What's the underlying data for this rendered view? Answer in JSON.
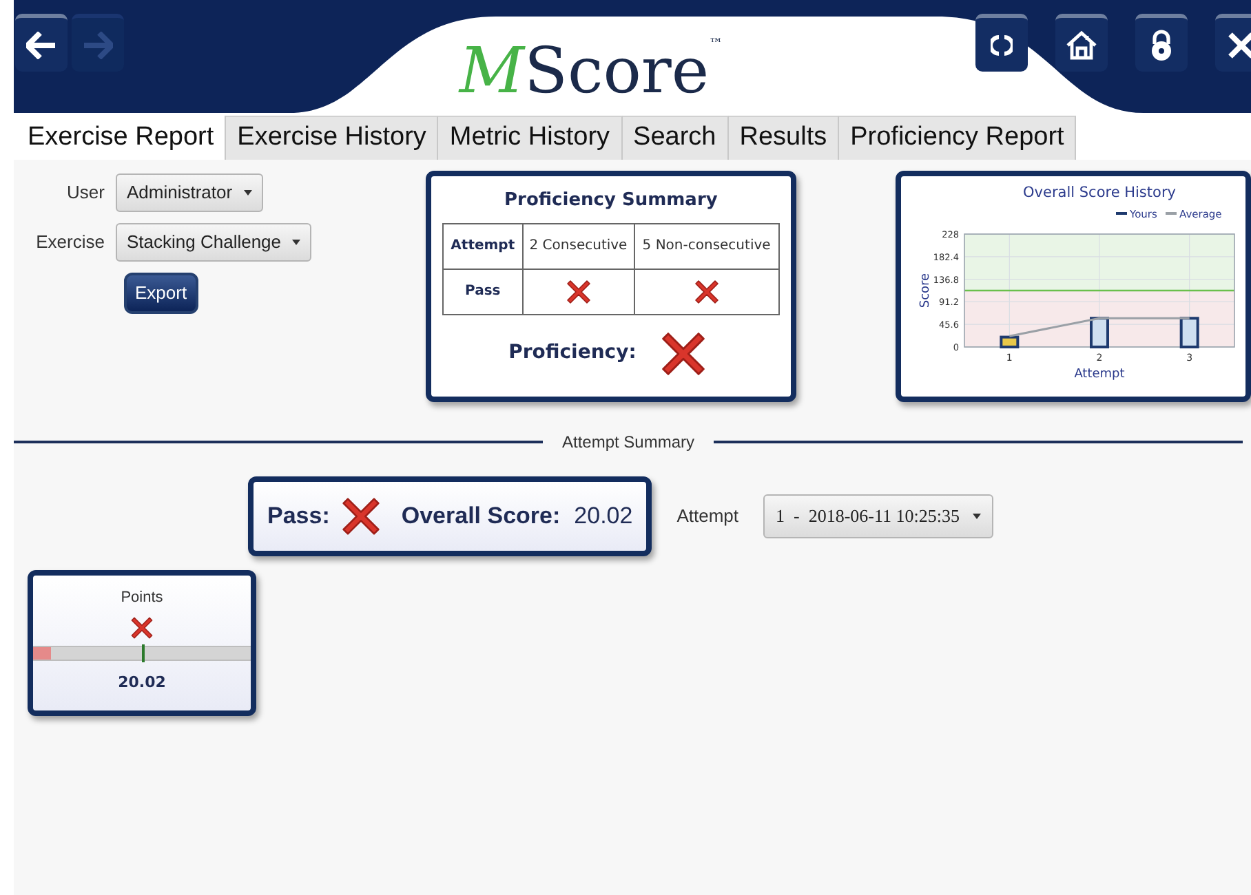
{
  "header": {
    "nav_buttons": [
      {
        "kind": "back",
        "disabled": false
      },
      {
        "kind": "forward",
        "disabled": true
      }
    ],
    "logo": {
      "accent": "M",
      "rest": "Score",
      "mark": "™"
    },
    "tool_buttons": [
      {
        "kind": "refresh"
      },
      {
        "kind": "home"
      },
      {
        "kind": "lock"
      },
      {
        "kind": "close"
      }
    ]
  },
  "tabs": [
    {
      "label": "Exercise Report",
      "selected": true
    },
    {
      "label": "Exercise History",
      "selected": false
    },
    {
      "label": "Metric History",
      "selected": false
    },
    {
      "label": "Search",
      "selected": false
    },
    {
      "label": "Results",
      "selected": false
    },
    {
      "label": "Proficiency Report",
      "selected": false
    }
  ],
  "filters": [
    {
      "label": "User",
      "value": "Administrator"
    },
    {
      "label": "Exercise",
      "value": "Stacking Challenge"
    }
  ],
  "export_button": "Export",
  "proficiency_summary": {
    "title": "Proficiency Summary",
    "row_header": "Attempt",
    "columns": [
      "2 Consecutive",
      "5 Non-consecutive"
    ],
    "pass_label": "Pass",
    "pass": [
      false,
      false
    ],
    "proficiency_label": "Proficiency:",
    "proficient": false
  },
  "score_history": {
    "chart_data": {
      "type": "bar",
      "title": "Overall Score History",
      "xlabel": "Attempt",
      "ylabel": "Score",
      "categories": [
        "1",
        "2",
        "3"
      ],
      "series": [
        {
          "name": "Yours",
          "color": "#1e3a6e",
          "values": [
            20,
            58,
            58
          ]
        },
        {
          "name": "Average",
          "type": "line",
          "color": "#9aa0a6",
          "values": [
            22,
            58,
            58
          ]
        }
      ],
      "grid": true,
      "legend": true,
      "ylim": [
        0,
        228
      ],
      "yticks": [
        0,
        45.6,
        91.2,
        136.8,
        182.4,
        228
      ],
      "ref_lines": [
        {
          "axis": "y",
          "value": 114,
          "color": "#6abf4b"
        }
      ]
    }
  },
  "attempt_summary": {
    "title": "Attempt Summary",
    "pass_label": "Pass:",
    "passed": false,
    "score_label": "Overall Score:",
    "score": "20.02",
    "attempt_label": "Attempt",
    "attempt_value": "1  -  2018-06-11 10:25:35"
  },
  "metrics": [
    {
      "name": "Points",
      "passed": false,
      "level": 0.08,
      "value": "20.02"
    }
  ]
}
